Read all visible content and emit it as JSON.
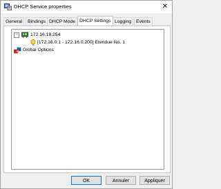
{
  "window": {
    "title": "DHCP Service properties",
    "close_glyph": "✕",
    "title_icon": "network-server-icon"
  },
  "tabs": [
    {
      "label": "General",
      "active": false
    },
    {
      "label": "Bindings",
      "active": false
    },
    {
      "label": "DHCP Mode",
      "active": false
    },
    {
      "label": "DHCP Settings",
      "active": true
    },
    {
      "label": "Logging",
      "active": false
    },
    {
      "label": "Events",
      "active": false
    }
  ],
  "tree": {
    "root": {
      "label": "172.16.18.254",
      "expander": "−",
      "icon": "network-adapter-icon",
      "children": [
        {
          "label": "[172.16.0.1 - 172.16.0.200] Etendue No. 1",
          "icon": "lightbulb-icon"
        }
      ]
    },
    "global": {
      "label": "Global Options",
      "icon": "global-options-icon"
    }
  },
  "buttons": {
    "ok": "OK",
    "cancel": "Annuler",
    "apply": "Appliquer"
  },
  "colors": {
    "accent": "#0078d7",
    "window_bg": "#f0f0f0"
  }
}
